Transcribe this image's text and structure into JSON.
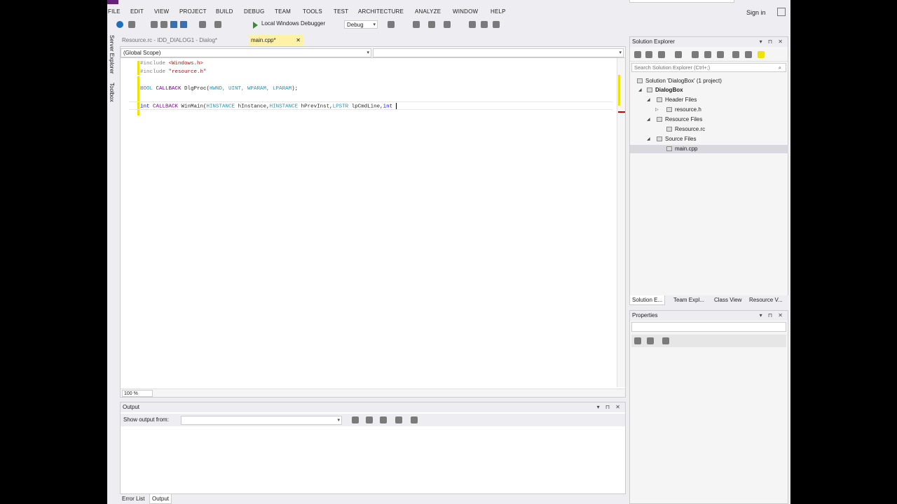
{
  "menu": [
    "FILE",
    "EDIT",
    "VIEW",
    "PROJECT",
    "BUILD",
    "DEBUG",
    "TEAM",
    "TOOLS",
    "TEST",
    "ARCHITECTURE",
    "ANALYZE",
    "WINDOW",
    "HELP"
  ],
  "sign_in": "Sign in",
  "toolbar": {
    "debugger_label": "Local Windows Debugger",
    "config": "Debug"
  },
  "side_tabs": [
    "Server Explorer",
    "Toolbox"
  ],
  "doc_tabs": [
    {
      "label": "Resource.rc - IDD_DIALOG1 - Dialog*",
      "active": false
    },
    {
      "label": "main.cpp*",
      "active": true
    }
  ],
  "editor": {
    "scope": "(Global Scope)",
    "zoom": "100 %",
    "lines": {
      "l1_directive": "#include",
      "l1_file": " <Windows.h>",
      "l2_directive": "#include",
      "l2_file": " \"resource.h\"",
      "l3_type": "BOOL",
      "l3_macro": " CALLBACK",
      "l3_name": " DlgProc(",
      "l3_params": "HWND, UINT, WPARAM, LPARAM",
      "l3_end": ");",
      "l4_kw": "int",
      "l4_macro": " CALLBACK",
      "l4_name": " WinMain(",
      "l4_t1": "HINSTANCE",
      "l4_p1": " hInstance,",
      "l4_t2": "HINSTANCE",
      "l4_p2": " hPrevInst,",
      "l4_t3": "LPSTR",
      "l4_p3": " lpCmdLine,",
      "l4_kw2": "int",
      "l4_p4": " "
    }
  },
  "output": {
    "title": "Output",
    "show_from": "Show output from:"
  },
  "bottom_tabs": [
    "Error List",
    "Output"
  ],
  "solution_explorer": {
    "title": "Solution Explorer",
    "search_placeholder": "Search Solution Explorer (Ctrl+;)",
    "solution": "Solution 'DialogBox' (1 project)",
    "project": "DialogBox",
    "header_files": "Header Files",
    "resource_h": "resource.h",
    "resource_files": "Resource Files",
    "resource_rc": "Resource.rc",
    "source_files": "Source Files",
    "main_cpp": "main.cpp"
  },
  "se_tabs": [
    "Solution E...",
    "Team Expl...",
    "Class View",
    "Resource V..."
  ],
  "properties": {
    "title": "Properties"
  }
}
